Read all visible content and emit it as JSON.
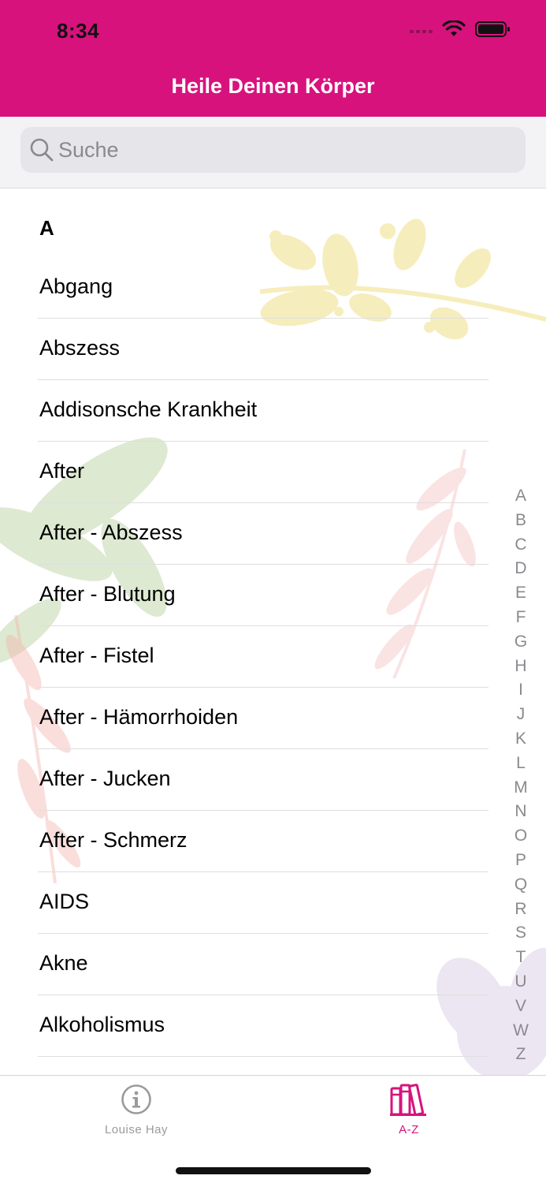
{
  "status_bar": {
    "time": "8:34"
  },
  "nav": {
    "title": "Heile Deinen Körper"
  },
  "search": {
    "placeholder": "Suche",
    "value": ""
  },
  "list": {
    "section": "A",
    "items": [
      "Abgang",
      "Abszess",
      "Addisonsche Krankheit",
      "After",
      "After - Abszess",
      "After - Blutung",
      "After - Fistel",
      "After - Hämorrhoiden",
      "After - Jucken",
      "After - Schmerz",
      "AIDS",
      "Akne",
      "Alkoholismus"
    ]
  },
  "index": [
    "A",
    "B",
    "C",
    "D",
    "E",
    "F",
    "G",
    "H",
    "I",
    "J",
    "K",
    "L",
    "M",
    "N",
    "O",
    "P",
    "Q",
    "R",
    "S",
    "T",
    "U",
    "V",
    "W",
    "Z"
  ],
  "tabs": [
    {
      "label": "Louise Hay",
      "icon": "info-icon",
      "selected": false
    },
    {
      "label": "A-Z",
      "icon": "books-icon",
      "selected": true
    }
  ],
  "colors": {
    "accent": "#d8127d",
    "inactive": "#9a9a9a"
  }
}
